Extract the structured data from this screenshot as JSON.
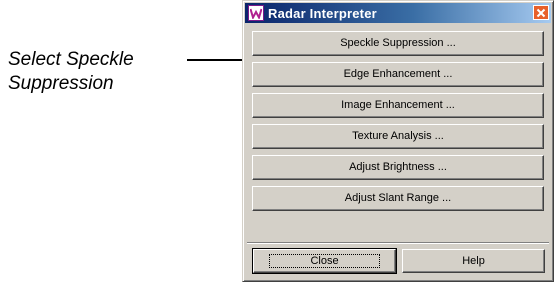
{
  "annotation": {
    "line1": "Select Speckle",
    "line2": "Suppression"
  },
  "window": {
    "title": "Radar Interpreter",
    "app_icon": "w-logo-icon",
    "close_icon": "close-icon",
    "buttons": [
      "Speckle Suppression ...",
      "Edge Enhancement ...",
      "Image Enhancement ...",
      "Texture Analysis ...",
      "Adjust Brightness ...",
      "Adjust Slant Range ..."
    ],
    "close_label": "Close",
    "help_label": "Help"
  },
  "colors": {
    "title_bar": "#0a246a",
    "face": "#d4d0c8",
    "close_button": "#e8602a"
  }
}
